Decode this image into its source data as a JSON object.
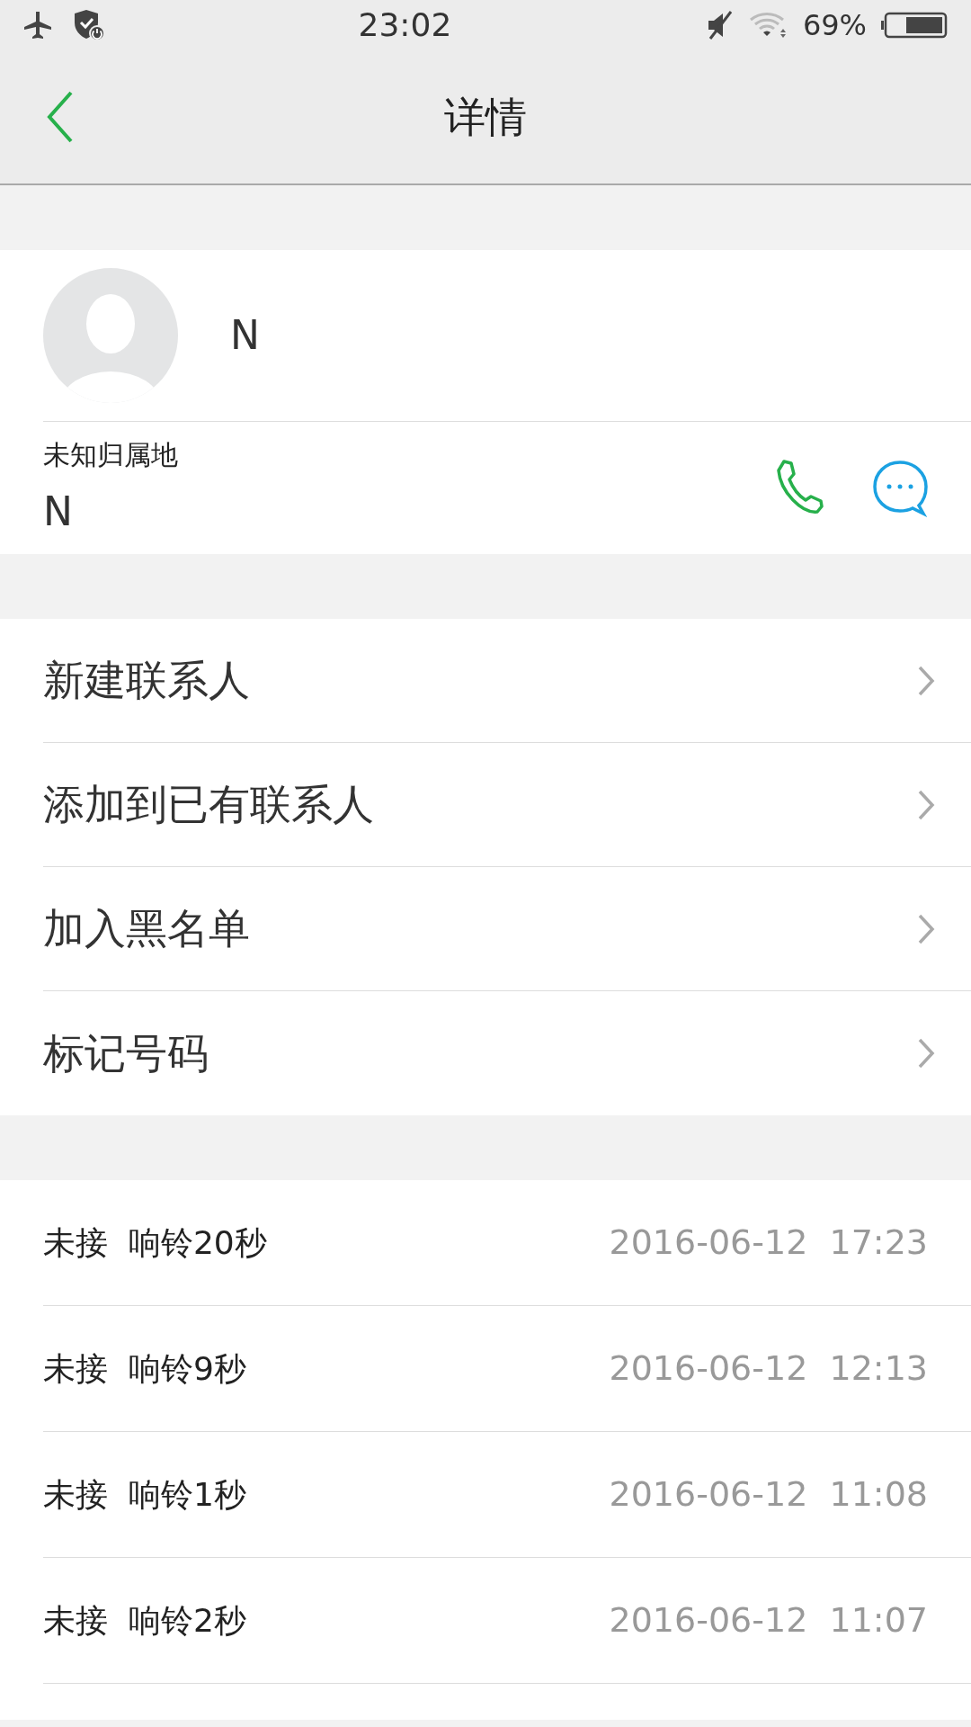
{
  "status_bar": {
    "time": "23:02",
    "battery": "69%"
  },
  "header": {
    "title": "详情"
  },
  "contact": {
    "name": "N",
    "location": "未知归属地",
    "number": "N"
  },
  "actions": [
    {
      "label": "新建联系人"
    },
    {
      "label": "添加到已有联系人"
    },
    {
      "label": "加入黑名单"
    },
    {
      "label": "标记号码"
    }
  ],
  "call_log": [
    {
      "status": "未接",
      "detail": "响铃20秒",
      "time": "2016-06-12  17:23"
    },
    {
      "status": "未接",
      "detail": "响铃9秒",
      "time": "2016-06-12  12:13"
    },
    {
      "status": "未接",
      "detail": "响铃1秒",
      "time": "2016-06-12  11:08"
    },
    {
      "status": "未接",
      "detail": "响铃2秒",
      "time": "2016-06-12  11:07"
    }
  ]
}
